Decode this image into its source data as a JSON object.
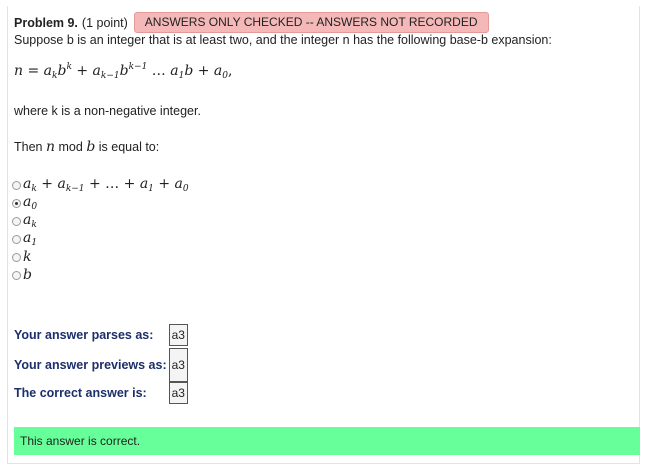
{
  "problem": {
    "title": "Problem 9.",
    "points": "(1 point)",
    "status_badge": "ANSWERS ONLY CHECKED -- ANSWERS NOT RECORDED",
    "statement": "Suppose b is an integer that is at least two, and the integer n has the following base-b expansion:",
    "expansion_math": "n = a_k b^k + a_{k-1} b^{k-1} ... a_1 b + a_0,",
    "where_text": "where k is a non-negative integer.",
    "question_prefix": "Then",
    "question_n": "n",
    "question_mid": "mod",
    "question_b": "b",
    "question_suffix": "is equal to:"
  },
  "options": [
    {
      "label": "a_k + a_{k-1} + ... + a_1 + a_0",
      "selected": false
    },
    {
      "label": "a_0",
      "selected": true
    },
    {
      "label": "a_k",
      "selected": false
    },
    {
      "label": "a_1",
      "selected": false
    },
    {
      "label": "k",
      "selected": false
    },
    {
      "label": "b",
      "selected": false
    }
  ],
  "results": {
    "parses_label": "Your answer parses as:",
    "parses_value": "a3",
    "previews_label": "Your answer previews as:",
    "previews_value": "a3",
    "correct_label": "The correct answer is:",
    "correct_value": "a3"
  },
  "feedback": {
    "message": "This answer is correct.",
    "color": "#66ff99"
  },
  "colors": {
    "badge_bg": "#f5b8b8",
    "result_label": "#1c2f6b"
  }
}
